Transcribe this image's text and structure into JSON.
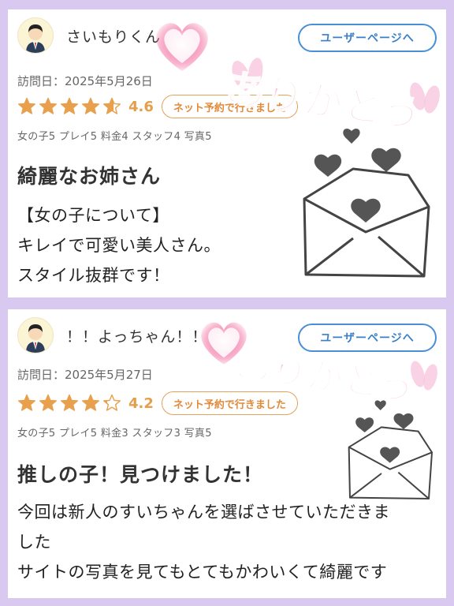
{
  "reviews": [
    {
      "username": "さいもりくん",
      "user_page_label": "ユーザーページへ",
      "visit_date": "訪問日：2025年5月26日",
      "rating": 4.6,
      "score_label": "4.6",
      "reservation_badge": "ネット予約で行きました",
      "scores": "女の子5 プレイ5 料金4 スタッフ4 写真5",
      "title": "綺麗なお姉さん",
      "body": [
        "【女の子について】",
        "キレイで可愛い美人さん。",
        "スタイル抜群です！"
      ]
    },
    {
      "username": "！！よっちゃん！！",
      "user_page_label": "ユーザーページへ",
      "visit_date": "訪問日：2025年5月27日",
      "rating": 4.2,
      "score_label": "4.2",
      "reservation_badge": "ネット予約で行きました",
      "scores": "女の子5 プレイ5 料金3 スタッフ3 写真5",
      "title": "推しの子！見つけました！",
      "body": [
        "今回は新人のすいちゃんを選ばさせていただきま",
        "した",
        "サイトの写真を見てもとてもかわいくて綺麗です"
      ]
    }
  ],
  "stickers": {
    "thanks_text": "ありがとう",
    "thanks_color": "#f7c4dc",
    "heart_color": "#f26a9a"
  },
  "colors": {
    "star": "#e8a04c",
    "star_empty": "#bdbdbd",
    "accent_blue": "#4a8fd6",
    "background": "#d9c8ef"
  }
}
